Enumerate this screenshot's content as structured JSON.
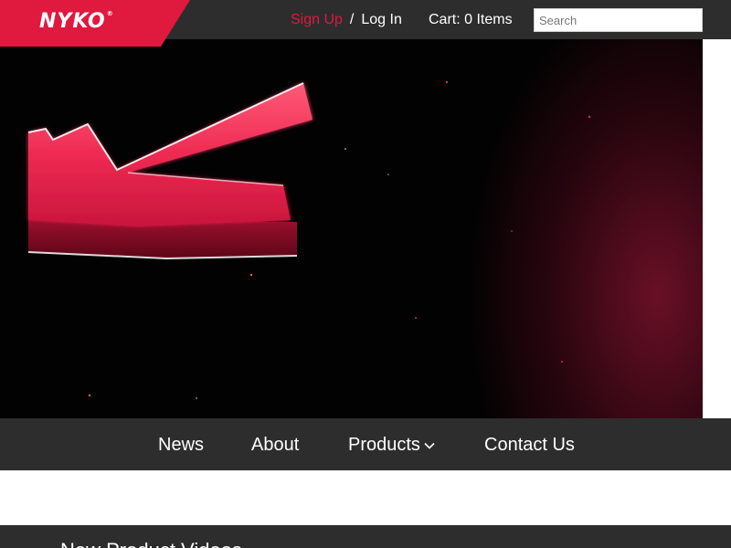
{
  "brand": {
    "logo_text": "NYKO",
    "registered_mark": "®",
    "accent_color": "#e0193f",
    "bar_color": "#2d2d2d"
  },
  "header": {
    "sign_up_label": "Sign Up",
    "separator": "/",
    "log_in_label": "Log In",
    "cart_label": "Cart: 0 Items",
    "search_placeholder": "Search"
  },
  "nav": {
    "items": [
      {
        "label": "News"
      },
      {
        "label": "About"
      },
      {
        "label": "Products",
        "icon": "chevron-down-icon"
      },
      {
        "label": "Contact Us"
      }
    ]
  },
  "section": {
    "heading": "New Product Videos"
  }
}
